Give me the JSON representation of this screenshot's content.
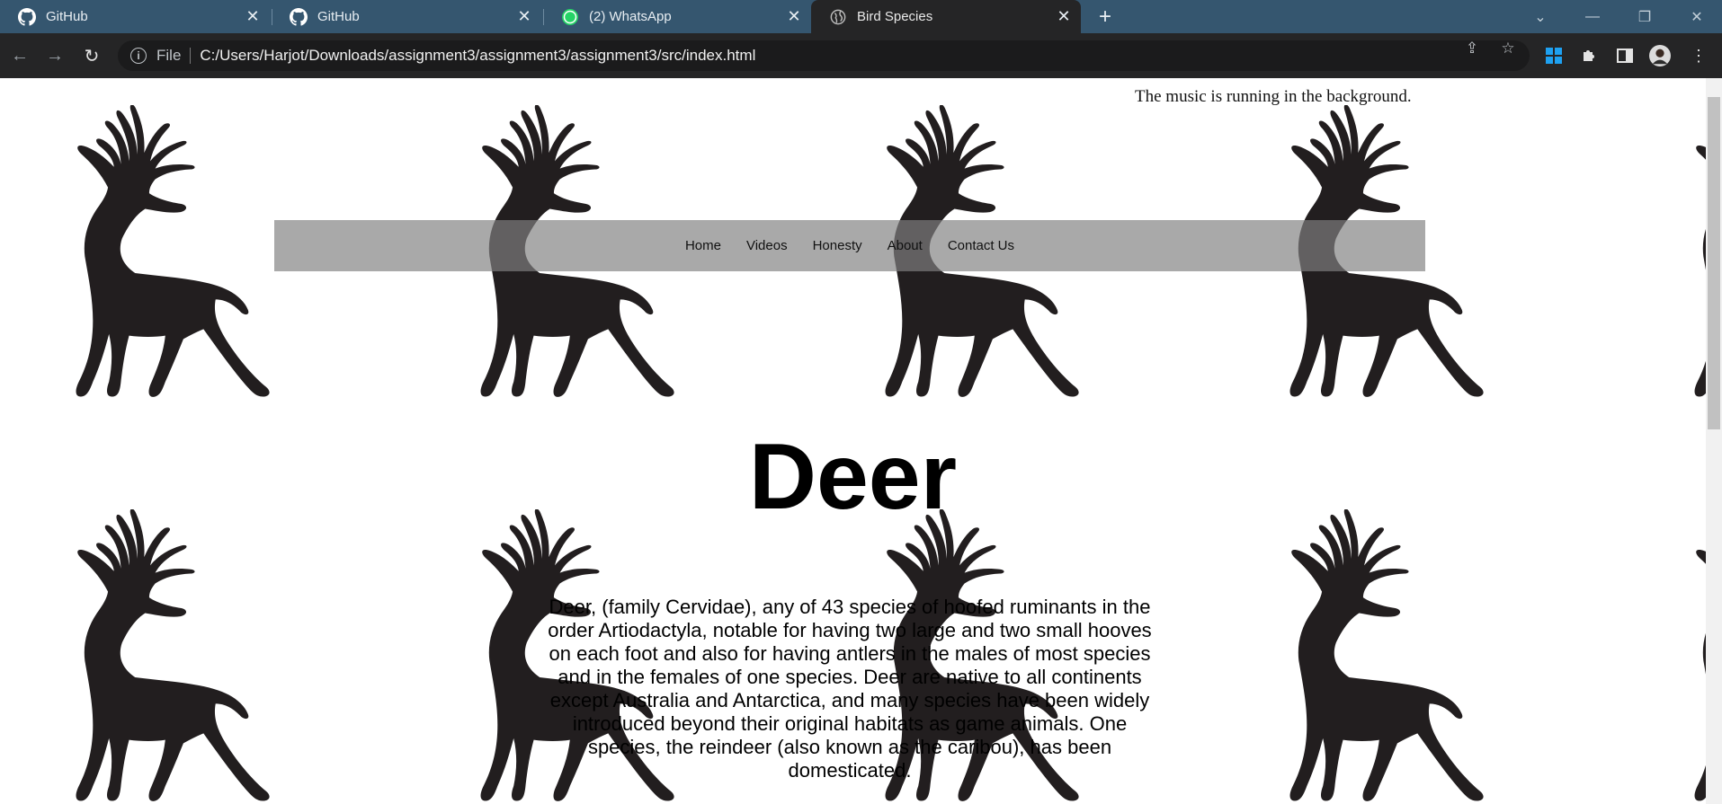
{
  "browser": {
    "tabs": [
      {
        "title": "GitHub",
        "icon": "github-icon",
        "active": false
      },
      {
        "title": "GitHub",
        "icon": "github-icon",
        "active": false
      },
      {
        "title": "(2) WhatsApp",
        "icon": "whatsapp-icon",
        "badge": "2",
        "active": false
      },
      {
        "title": "Bird Species",
        "icon": "globe-icon",
        "active": true
      }
    ],
    "address": {
      "scheme_label": "File",
      "url": "C:/Users/Harjot/Downloads/assignment3/assignment3/assignment3/src/index.html"
    }
  },
  "page": {
    "music_note": "The music is running in the background.",
    "nav": [
      "Home",
      "Videos",
      "Honesty",
      "About",
      "Contact Us"
    ],
    "heading": "Deer",
    "paragraph": "Deer, (family Cervidae), any of 43 species of hoofed ruminants in the order Artiodactyla, notable for having two large and two small hooves on each foot and also for having antlers in the males of most species and in the females of one species. Deer are native to all continents except Australia and Antarctica, and many species have been widely introduced beyond their original habitats as game animals. One species, the reindeer (also known as the caribou), has been domesticated."
  },
  "colors": {
    "tabstrip": "#35566f",
    "toolbar": "#252526",
    "deer_silhouette": "#221e1f",
    "nav_band": "#808080"
  }
}
